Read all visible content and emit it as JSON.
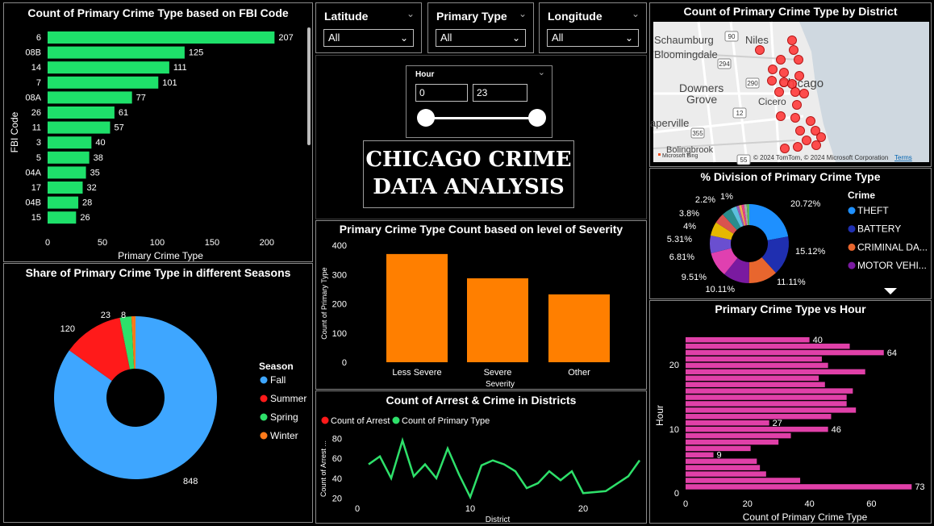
{
  "fbi": {
    "title": "Count of Primary Crime Type based on FBI Code",
    "ylabel": "FBI Code",
    "xlabel": "Primary Crime Type",
    "codes": [
      "6",
      "08B",
      "14",
      "7",
      "08A",
      "26",
      "11",
      "3",
      "5",
      "04A",
      "17",
      "04B",
      "15"
    ],
    "values": [
      207,
      125,
      111,
      101,
      77,
      61,
      57,
      40,
      38,
      35,
      32,
      28,
      26
    ],
    "ticks": [
      "0",
      "50",
      "100",
      "150",
      "200"
    ],
    "color": "#1ee06a"
  },
  "seasons": {
    "title": "Share of Primary Crime Type in different Seasons",
    "legend_title": "Season",
    "items": [
      {
        "name": "Fall",
        "value": 848,
        "color": "#3ea6ff"
      },
      {
        "name": "Summer",
        "value": 120,
        "color": "#ff1a1a"
      },
      {
        "name": "Spring",
        "value": 23,
        "color": "#2ee06a"
      },
      {
        "name": "Winter",
        "value": 8,
        "color": "#ff7a1a"
      }
    ]
  },
  "slicers": {
    "latitude": {
      "label": "Latitude",
      "value": "All"
    },
    "primary_type": {
      "label": "Primary Type",
      "value": "All"
    },
    "longitude": {
      "label": "Longitude",
      "value": "All"
    },
    "hour": {
      "label": "Hour",
      "min": "0",
      "max": "23"
    }
  },
  "banner": {
    "line1": "CHICAGO CRIME",
    "line2": "DATA ANALYSIS"
  },
  "severity": {
    "title": "Primary Crime Type Count based on level of Severity",
    "ylabel": "Count of Primary Type",
    "xlabel": "Severity",
    "categories": [
      "Less Severe",
      "Severe",
      "Other"
    ],
    "values": [
      370,
      287,
      232
    ],
    "ticks": [
      "0",
      "100",
      "200",
      "300",
      "400"
    ],
    "color": "#ff7f00"
  },
  "arrest": {
    "title": "Count of Arrest & Crime in Districts",
    "legend": [
      {
        "name": "Count of Arrest",
        "color": "#ff1a1a"
      },
      {
        "name": "Count of Primary Type",
        "color": "#2ee06a"
      }
    ],
    "ylabel": "Count of Arrest ...",
    "xlabel": "District",
    "yticks": [
      "20",
      "40",
      "60",
      "80"
    ],
    "xticks": [
      "0",
      "10",
      "20"
    ]
  },
  "map": {
    "title": "Count of Primary Crime Type by District",
    "places": [
      "Schaumburg",
      "Niles",
      "Bloomingdale",
      "Downers",
      "Grove",
      "Chicago",
      "Cicero",
      "aperville",
      "Bolingbrook"
    ],
    "roads": [
      "90",
      "294",
      "290",
      "12",
      "355",
      "55"
    ],
    "copyright": "© 2024 TomTom, © 2024 Microsoft Corporation",
    "terms": "Terms",
    "bing": "Microsoft Bing"
  },
  "division": {
    "title": "% Division of Primary Crime Type",
    "legend_title": "Crime",
    "legend": [
      {
        "name": "THEFT",
        "color": "#1e90ff"
      },
      {
        "name": "BATTERY",
        "color": "#1f2fb0"
      },
      {
        "name": "CRIMINAL DA...",
        "color": "#e8662e"
      },
      {
        "name": "MOTOR VEHI...",
        "color": "#7a1aa0"
      }
    ],
    "slices": [
      {
        "label": "20.72%",
        "value": 20.72,
        "color": "#1e90ff"
      },
      {
        "label": "15.12%",
        "value": 15.12,
        "color": "#1f2fb0"
      },
      {
        "label": "11.11%",
        "value": 11.11,
        "color": "#e8662e"
      },
      {
        "label": "10.11%",
        "value": 10.11,
        "color": "#7a1aa0"
      },
      {
        "label": "9.51%",
        "value": 9.51,
        "color": "#e040b0"
      },
      {
        "label": "6.81%",
        "value": 6.81,
        "color": "#6a4fd0"
      },
      {
        "label": "5.31%",
        "value": 5.31,
        "color": "#e6b800"
      },
      {
        "label": "4%",
        "value": 4.0,
        "color": "#d9534f"
      },
      {
        "label": "3.8%",
        "value": 3.8,
        "color": "#2a8c8c"
      },
      {
        "label": "2.2%",
        "value": 2.2,
        "color": "#5bc0de"
      },
      {
        "label": "1%",
        "value": 1.0,
        "color": "#9b59b6"
      },
      {
        "label": "",
        "value": 1.0,
        "color": "#f0ad4e"
      },
      {
        "label": "",
        "value": 1.0,
        "color": "#e83e8c"
      },
      {
        "label": "",
        "value": 1.0,
        "color": "#aaaaaa"
      },
      {
        "label": "",
        "value": 1.0,
        "color": "#5cb85c"
      }
    ]
  },
  "hour": {
    "title": "Primary Crime Type vs Hour",
    "ylabel": "Hour",
    "xlabel": "Count of Primary Crime Type",
    "xticks": [
      "0",
      "20",
      "40",
      "60"
    ],
    "yticks": [
      "0",
      "10",
      "20"
    ],
    "color": "#e040a8"
  },
  "chart_data": [
    {
      "type": "bar",
      "title": "Count of Primary Crime Type based on FBI Code",
      "categories": [
        "6",
        "08B",
        "14",
        "7",
        "08A",
        "26",
        "11",
        "3",
        "5",
        "04A",
        "17",
        "04B",
        "15"
      ],
      "values": [
        207,
        125,
        111,
        101,
        77,
        61,
        57,
        40,
        38,
        35,
        32,
        28,
        26
      ],
      "xlabel": "Primary Crime Type",
      "ylabel": "FBI Code",
      "xlim": [
        0,
        220
      ]
    },
    {
      "type": "pie",
      "title": "Share of Primary Crime Type in different Seasons",
      "categories": [
        "Fall",
        "Summer",
        "Spring",
        "Winter"
      ],
      "values": [
        848,
        120,
        23,
        8
      ]
    },
    {
      "type": "bar",
      "title": "Primary Crime Type Count based on level of Severity",
      "categories": [
        "Less Severe",
        "Severe",
        "Other"
      ],
      "values": [
        370,
        287,
        232
      ],
      "xlabel": "Severity",
      "ylabel": "Count of Primary Type",
      "ylim": [
        0,
        400
      ]
    },
    {
      "type": "line",
      "title": "Count of Arrest & Crime in Districts",
      "xlabel": "District",
      "ylabel": "Count of Arrest ...",
      "ylim": [
        10,
        85
      ],
      "x": [
        1,
        2,
        3,
        4,
        5,
        6,
        7,
        8,
        9,
        10,
        11,
        12,
        13,
        14,
        15,
        16,
        17,
        18,
        19,
        20,
        22,
        24,
        25
      ],
      "series": [
        {
          "name": "Count of Primary Type",
          "values": [
            54,
            62,
            40,
            78,
            42,
            54,
            40,
            70,
            44,
            21,
            53,
            58,
            54,
            47,
            30,
            35,
            47,
            38,
            47,
            25,
            27,
            42,
            58
          ]
        }
      ]
    },
    {
      "type": "pie",
      "title": "% Division of Primary Crime Type",
      "categories": [
        "THEFT",
        "BATTERY",
        "CRIMINAL DA...",
        "MOTOR VEHI..."
      ],
      "values": [
        20.72,
        15.12,
        11.11,
        10.11,
        9.51,
        6.81,
        5.31,
        4,
        3.8,
        2.2,
        1
      ]
    },
    {
      "type": "bar",
      "title": "Primary Crime Type vs Hour",
      "xlabel": "Count of Primary Crime Type",
      "ylabel": "Hour",
      "xlim": [
        0,
        75
      ],
      "categories": [
        "23",
        "22",
        "21",
        "20",
        "19",
        "18",
        "17",
        "16",
        "15",
        "14",
        "13",
        "12",
        "11",
        "10",
        "9",
        "8",
        "7",
        "6",
        "5",
        "4",
        "3",
        "2",
        "1",
        "0"
      ],
      "values": [
        40,
        53,
        64,
        44,
        46,
        58,
        43,
        45,
        54,
        52,
        52,
        55,
        47,
        27,
        46,
        34,
        30,
        21,
        9,
        23,
        24,
        26,
        37,
        73
      ]
    }
  ]
}
